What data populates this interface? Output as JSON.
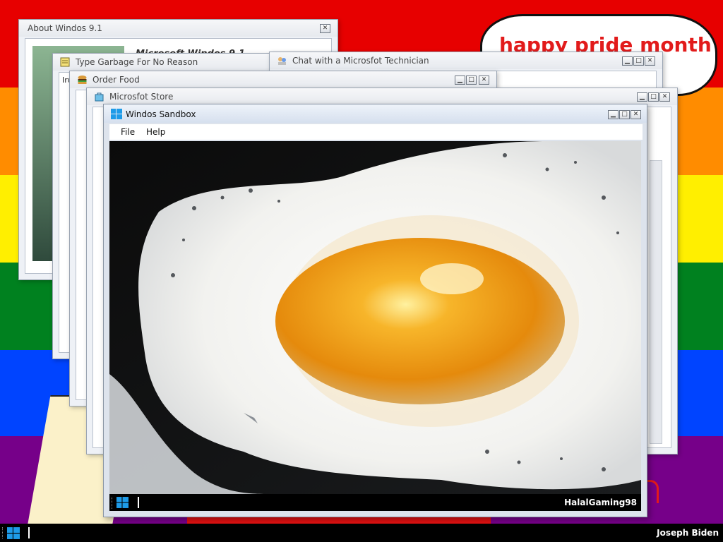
{
  "desktop": {
    "flag_colors": [
      "#e70000",
      "#ff8c00",
      "#ffef00",
      "#00811f",
      "#0044ff",
      "#760089"
    ],
    "speech_bubble_text": "happy pride month"
  },
  "windows": {
    "about": {
      "title": "About Windos 9.1",
      "body_text": "Microsoft Windos 9.1"
    },
    "type_garbage": {
      "title": "Type Garbage For No Reason",
      "text_value": "Iru"
    },
    "chat": {
      "title": "Chat with a Microsfot Technician"
    },
    "order_food": {
      "title": "Order Food"
    },
    "store": {
      "title": "Microsfot Store"
    }
  },
  "sandbox": {
    "title": "Windos Sandbox",
    "menu": {
      "file": "File",
      "help": "Help"
    },
    "inner_username": "HalalGaming98"
  },
  "taskbar": {
    "username": "Joseph Biden"
  },
  "icons": {
    "minimize": "minimize-icon",
    "maximize": "maximize-icon",
    "close": "close-icon",
    "windows_logo": "windows-logo-icon"
  },
  "colors": {
    "accent": "#1e9be8",
    "bubble_text": "#e21b1b",
    "taskbar": "#000000"
  }
}
